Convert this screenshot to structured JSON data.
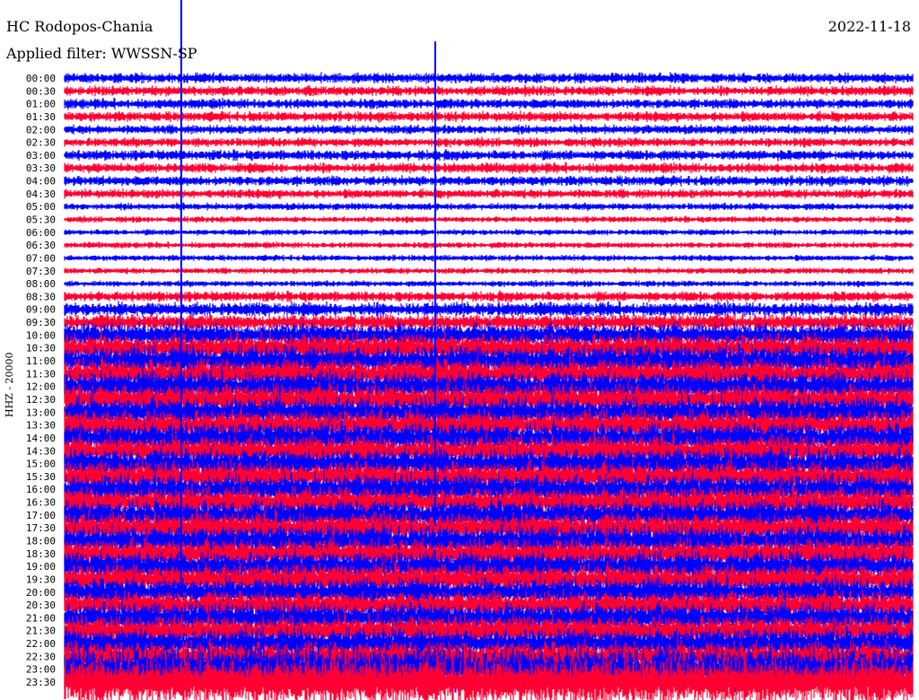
{
  "header": {
    "station": "HC Rodopos-Chania",
    "date": "2022-11-18",
    "filter": "Applied filter: WWSSN-SP"
  },
  "chart_data": {
    "type": "line",
    "title": "HC Rodopos-Chania",
    "ylabel": "HHZ - 20000",
    "xlabel": "",
    "colors": [
      "#0000ff",
      "#ff0033"
    ],
    "row_labels": [
      "00:00",
      "00:30",
      "01:00",
      "01:30",
      "02:00",
      "02:30",
      "03:00",
      "03:30",
      "04:00",
      "04:30",
      "05:00",
      "05:30",
      "06:00",
      "06:30",
      "07:00",
      "07:30",
      "08:00",
      "08:30",
      "09:00",
      "09:30",
      "10:00",
      "10:30",
      "11:00",
      "11:30",
      "12:00",
      "12:30",
      "13:00",
      "13:30",
      "14:00",
      "14:30",
      "15:00",
      "15:30",
      "16:00",
      "16:30",
      "17:00",
      "17:30",
      "18:00",
      "18:30",
      "19:00",
      "19:30",
      "20:00",
      "20:30",
      "21:00",
      "21:30",
      "22:00",
      "22:30",
      "23:00",
      "23:30"
    ],
    "relative_amplitude": [
      0.5,
      0.5,
      0.5,
      0.5,
      0.45,
      0.45,
      0.5,
      0.5,
      0.5,
      0.45,
      0.35,
      0.3,
      0.3,
      0.3,
      0.3,
      0.3,
      0.3,
      0.5,
      0.7,
      0.8,
      1.2,
      1.4,
      1.5,
      1.5,
      1.5,
      1.5,
      1.5,
      1.5,
      1.5,
      1.5,
      1.5,
      1.5,
      1.5,
      1.5,
      1.5,
      1.5,
      1.5,
      1.5,
      1.5,
      1.5,
      1.4,
      1.4,
      1.5,
      1.5,
      1.5,
      1.5,
      2.2,
      2.4
    ],
    "events": [
      {
        "row": "01:00",
        "color": "#0000ff",
        "relative_amplitude": 12
      },
      {
        "row": "08:00",
        "color": "#0000ff",
        "relative_amplitude": 6
      }
    ]
  }
}
